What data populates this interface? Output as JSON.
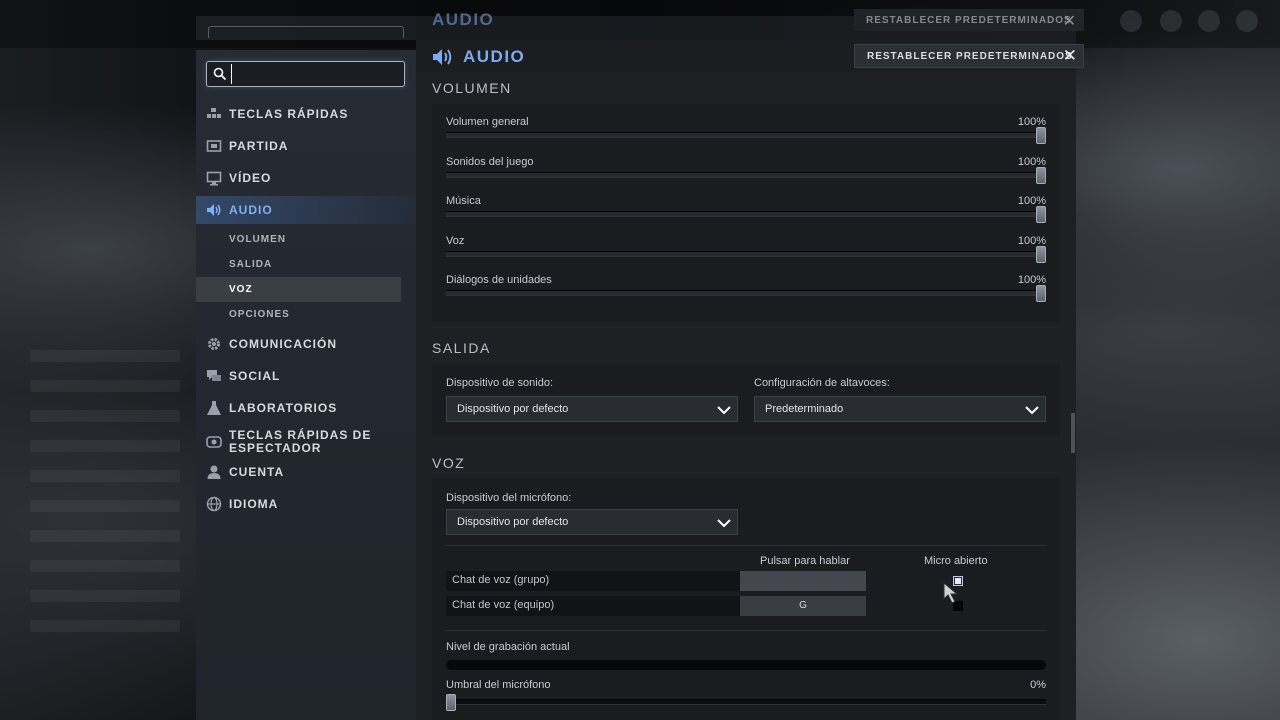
{
  "window": {
    "title": "AUDIO",
    "reset_label": "RESTABLECER PREDETERMINADOS",
    "close_glyph": "✕"
  },
  "search": {
    "placeholder": "",
    "value": ""
  },
  "sidebar": {
    "items": [
      {
        "label": "TECLAS RÁPIDAS",
        "icon": "hotkeys-icon"
      },
      {
        "label": "PARTIDA",
        "icon": "game-icon"
      },
      {
        "label": "VÍDEO",
        "icon": "monitor-icon"
      },
      {
        "label": "AUDIO",
        "icon": "speaker-icon",
        "active": true
      },
      {
        "label": "COMUNICACIÓN",
        "icon": "gear-icon"
      },
      {
        "label": "SOCIAL",
        "icon": "chat-icon"
      },
      {
        "label": "LABORATORIOS",
        "icon": "flask-icon"
      },
      {
        "label": "TECLAS RÁPIDAS DE ESPECTADOR",
        "icon": "spectator-icon"
      },
      {
        "label": "CUENTA",
        "icon": "user-icon"
      },
      {
        "label": "IDIOMA",
        "icon": "globe-icon"
      }
    ],
    "audio_sub": [
      "VOLUMEN",
      "SALIDA",
      "VOZ",
      "OPCIONES"
    ],
    "selected_sub": "VOZ"
  },
  "volume": {
    "section_title": "VOLUMEN",
    "sliders": [
      {
        "label": "Volumen general",
        "value_text": "100%",
        "value": 100
      },
      {
        "label": "Sonidos del juego",
        "value_text": "100%",
        "value": 100
      },
      {
        "label": "Música",
        "value_text": "100%",
        "value": 100
      },
      {
        "label": "Voz",
        "value_text": "100%",
        "value": 100
      },
      {
        "label": "Diálogos de unidades",
        "value_text": "100%",
        "value": 100
      }
    ]
  },
  "output": {
    "section_title": "SALIDA",
    "device_label": "Dispositivo de sonido:",
    "device_value": "Dispositivo por defecto",
    "speaker_label": "Configuración de altavoces:",
    "speaker_value": "Predeterminado"
  },
  "voice": {
    "section_title": "VOZ",
    "mic_label": "Dispositivo del micrófono:",
    "mic_value": "Dispositivo por defecto",
    "col_ptt": "Pulsar para hablar",
    "col_open": "Micro abierto",
    "rows": [
      {
        "label": "Chat de voz (grupo)",
        "key": "",
        "open_mic": true
      },
      {
        "label": "Chat de voz (equipo)",
        "key": "G",
        "open_mic": false
      }
    ],
    "record_level_label": "Nivel de grabación actual",
    "record_level": 0,
    "threshold_label": "Umbral del micrófono",
    "threshold_text": "0%",
    "threshold": 0
  },
  "colors": {
    "accent": "#7faaf0",
    "panel": "#1e2024",
    "sidebar": "#262b34"
  }
}
